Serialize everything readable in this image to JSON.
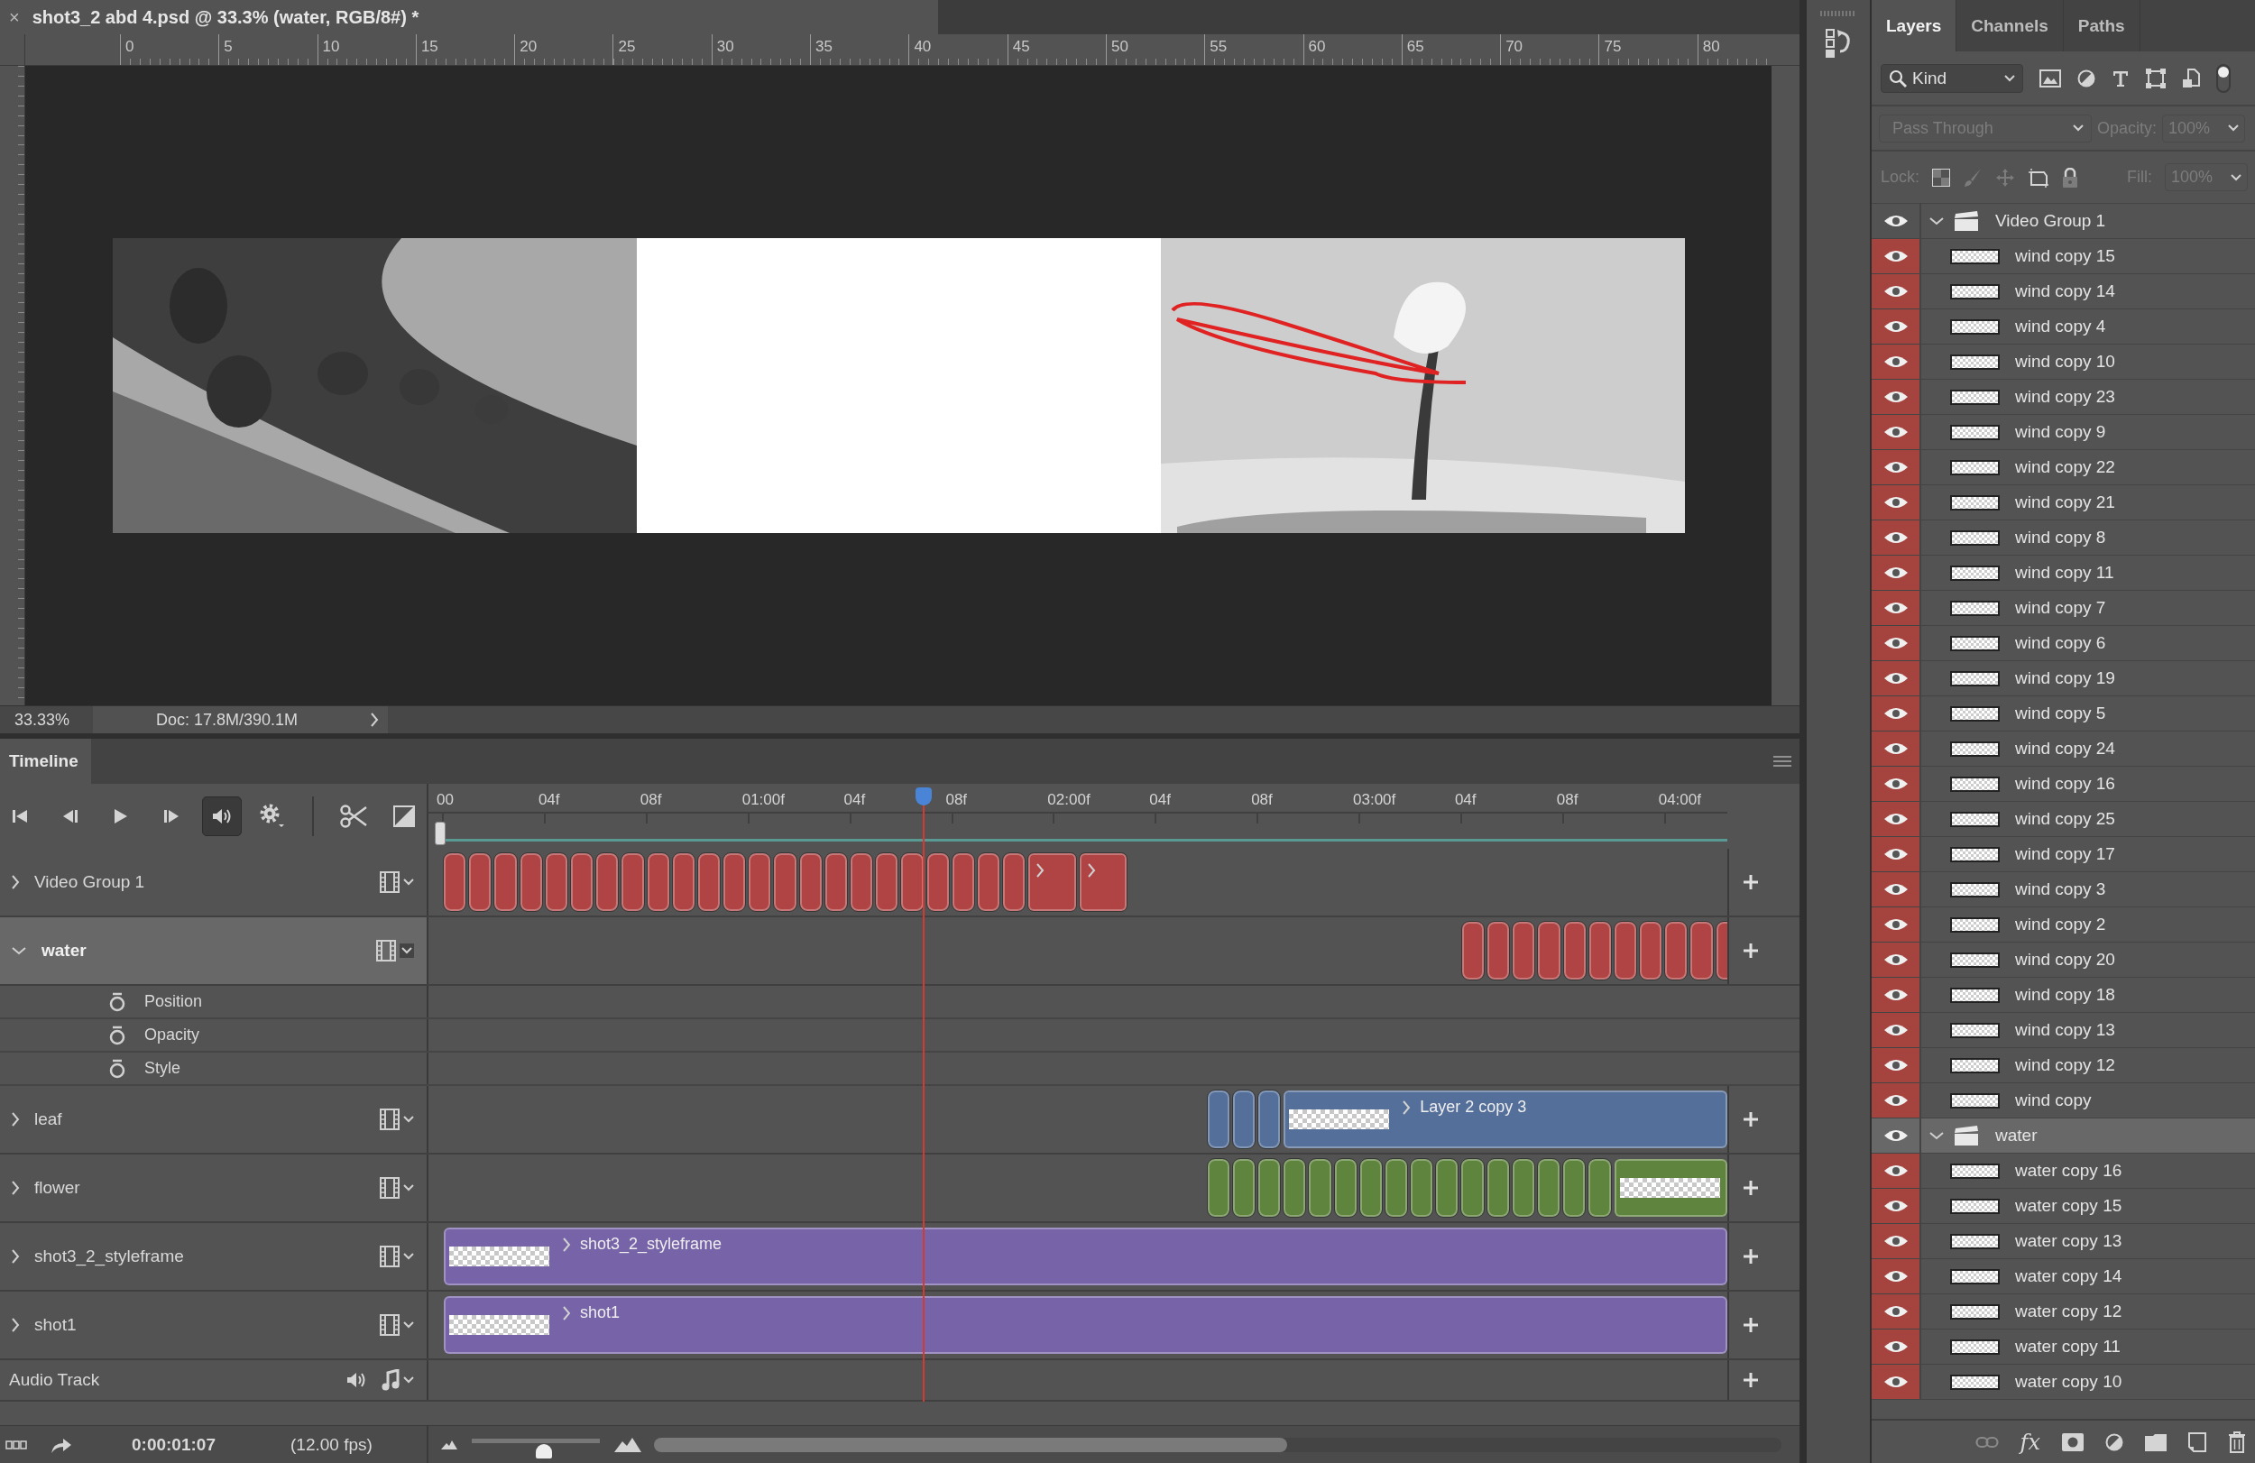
{
  "document_tab": {
    "close": "×",
    "title": "shot3_2 abd 4.psd @ 33.3% (water, RGB/8#) *"
  },
  "ruler": {
    "labels": [
      "0",
      "5",
      "10",
      "15",
      "20",
      "25",
      "30",
      "35",
      "40",
      "45",
      "50",
      "55",
      "60",
      "65",
      "70",
      "75",
      "80"
    ]
  },
  "status_bar": {
    "zoom": "33.33%",
    "doc_info": "Doc: 17.8M/390.1M"
  },
  "timeline": {
    "tab": "Timeline",
    "controls": [
      {
        "kind": "first-frame",
        "pressed": false
      },
      {
        "kind": "previous-frame",
        "pressed": false
      },
      {
        "kind": "play",
        "pressed": false
      },
      {
        "kind": "next-frame",
        "pressed": false
      },
      {
        "kind": "audio",
        "pressed": true
      },
      {
        "kind": "settings",
        "pressed": false
      },
      {
        "kind": "split",
        "pressed": false
      },
      {
        "kind": "transition",
        "pressed": false
      }
    ],
    "ruler_labels": [
      "00",
      "04f",
      "08f",
      "01:00f",
      "04f",
      "08f",
      "02:00f",
      "04f",
      "08f",
      "03:00f",
      "04f",
      "08f",
      "04:00f"
    ],
    "playhead": {
      "level": 0.381
    },
    "tracks": [
      {
        "name": "Video Group 1",
        "kind": "video",
        "expanded": false,
        "selected": false,
        "color": "#b04444",
        "clips": [
          {
            "kind": "frame"
          },
          {
            "kind": "frame"
          },
          {
            "kind": "frame"
          },
          {
            "kind": "frame"
          },
          {
            "kind": "frame"
          },
          {
            "kind": "frame"
          },
          {
            "kind": "frame"
          },
          {
            "kind": "frame"
          },
          {
            "kind": "frame"
          },
          {
            "kind": "frame"
          },
          {
            "kind": "frame"
          },
          {
            "kind": "frame"
          },
          {
            "kind": "frame"
          },
          {
            "kind": "frame"
          },
          {
            "kind": "frame"
          },
          {
            "kind": "frame"
          },
          {
            "kind": "frame"
          },
          {
            "kind": "frame"
          },
          {
            "kind": "frame"
          },
          {
            "kind": "frame"
          },
          {
            "kind": "frame"
          },
          {
            "kind": "frame"
          },
          {
            "kind": "frame"
          },
          {
            "kind": "group"
          },
          {
            "kind": "group"
          }
        ]
      },
      {
        "name": "water",
        "kind": "video",
        "expanded": true,
        "selected": true,
        "color": "#b04444",
        "properties": [
          "Position",
          "Opacity",
          "Style"
        ],
        "clips": [
          {
            "kind": "blank"
          },
          {
            "kind": "blank"
          },
          {
            "kind": "blank"
          },
          {
            "kind": "blank"
          },
          {
            "kind": "blank"
          },
          {
            "kind": "blank"
          },
          {
            "kind": "blank"
          },
          {
            "kind": "blank"
          },
          {
            "kind": "blank"
          },
          {
            "kind": "blank"
          },
          {
            "kind": "blank"
          },
          {
            "kind": "blank"
          },
          {
            "kind": "blank"
          },
          {
            "kind": "blank"
          },
          {
            "kind": "blank"
          },
          {
            "kind": "blank"
          },
          {
            "kind": "blank"
          },
          {
            "kind": "blank"
          },
          {
            "kind": "blank"
          },
          {
            "kind": "blank"
          },
          {
            "kind": "blank"
          },
          {
            "kind": "blank"
          },
          {
            "kind": "blank"
          },
          {
            "kind": "blank"
          },
          {
            "kind": "blank"
          },
          {
            "kind": "blank"
          },
          {
            "kind": "blank"
          },
          {
            "kind": "blank"
          },
          {
            "kind": "blank"
          },
          {
            "kind": "blank"
          },
          {
            "kind": "blank"
          },
          {
            "kind": "blank"
          },
          {
            "kind": "blank"
          },
          {
            "kind": "blank"
          },
          {
            "kind": "blank"
          },
          {
            "kind": "blank"
          },
          {
            "kind": "blank"
          },
          {
            "kind": "blank"
          },
          {
            "kind": "blank"
          },
          {
            "kind": "blank"
          },
          {
            "kind": "frame"
          },
          {
            "kind": "frame"
          },
          {
            "kind": "frame"
          },
          {
            "kind": "frame"
          },
          {
            "kind": "frame"
          },
          {
            "kind": "frame"
          },
          {
            "kind": "frame"
          },
          {
            "kind": "frame"
          },
          {
            "kind": "frame"
          },
          {
            "kind": "frame"
          },
          {
            "kind": "frame"
          }
        ]
      },
      {
        "name": "leaf",
        "kind": "video",
        "expanded": false,
        "selected": false,
        "color": "#536f9a",
        "clips": [
          {
            "kind": "blank"
          },
          {
            "kind": "blank"
          },
          {
            "kind": "blank"
          },
          {
            "kind": "blank"
          },
          {
            "kind": "blank"
          },
          {
            "kind": "blank"
          },
          {
            "kind": "blank"
          },
          {
            "kind": "blank"
          },
          {
            "kind": "blank"
          },
          {
            "kind": "blank"
          },
          {
            "kind": "blank"
          },
          {
            "kind": "blank"
          },
          {
            "kind": "blank"
          },
          {
            "kind": "blank"
          },
          {
            "kind": "blank"
          },
          {
            "kind": "blank"
          },
          {
            "kind": "blank"
          },
          {
            "kind": "blank"
          },
          {
            "kind": "blank"
          },
          {
            "kind": "blank"
          },
          {
            "kind": "blank"
          },
          {
            "kind": "blank"
          },
          {
            "kind": "blank"
          },
          {
            "kind": "blank"
          },
          {
            "kind": "blank"
          },
          {
            "kind": "blank"
          },
          {
            "kind": "blank"
          },
          {
            "kind": "blank"
          },
          {
            "kind": "blank"
          },
          {
            "kind": "blank"
          },
          {
            "kind": "frame"
          },
          {
            "kind": "frame"
          },
          {
            "kind": "frame"
          },
          {
            "kind": "clip",
            "label": "Layer 2 copy 3",
            "thumbnail": true
          }
        ]
      },
      {
        "name": "flower",
        "kind": "video",
        "expanded": false,
        "selected": false,
        "color": "#5f843e",
        "clips": [
          {
            "kind": "blank"
          },
          {
            "kind": "blank"
          },
          {
            "kind": "blank"
          },
          {
            "kind": "blank"
          },
          {
            "kind": "blank"
          },
          {
            "kind": "blank"
          },
          {
            "kind": "blank"
          },
          {
            "kind": "blank"
          },
          {
            "kind": "blank"
          },
          {
            "kind": "blank"
          },
          {
            "kind": "blank"
          },
          {
            "kind": "blank"
          },
          {
            "kind": "blank"
          },
          {
            "kind": "blank"
          },
          {
            "kind": "blank"
          },
          {
            "kind": "blank"
          },
          {
            "kind": "blank"
          },
          {
            "kind": "blank"
          },
          {
            "kind": "blank"
          },
          {
            "kind": "blank"
          },
          {
            "kind": "blank"
          },
          {
            "kind": "blank"
          },
          {
            "kind": "blank"
          },
          {
            "kind": "blank"
          },
          {
            "kind": "blank"
          },
          {
            "kind": "blank"
          },
          {
            "kind": "blank"
          },
          {
            "kind": "blank"
          },
          {
            "kind": "blank"
          },
          {
            "kind": "blank"
          },
          {
            "kind": "frame"
          },
          {
            "kind": "frame"
          },
          {
            "kind": "frame"
          },
          {
            "kind": "frame"
          },
          {
            "kind": "frame"
          },
          {
            "kind": "frame"
          },
          {
            "kind": "frame"
          },
          {
            "kind": "frame"
          },
          {
            "kind": "frame"
          },
          {
            "kind": "frame"
          },
          {
            "kind": "frame"
          },
          {
            "kind": "frame"
          },
          {
            "kind": "frame"
          },
          {
            "kind": "frame"
          },
          {
            "kind": "frame"
          },
          {
            "kind": "frame"
          },
          {
            "kind": "clip",
            "thumbnail": true
          }
        ]
      },
      {
        "name": "shot3_2_styleframe",
        "kind": "video",
        "expanded": false,
        "selected": false,
        "color": "#7763a8",
        "clips": [
          {
            "kind": "clip",
            "label": "shot3_2_styleframe",
            "thumbnail": true
          }
        ]
      },
      {
        "name": "shot1",
        "kind": "video",
        "expanded": false,
        "selected": false,
        "color": "#7763a8",
        "clips": [
          {
            "kind": "clip",
            "label": "shot1",
            "thumbnail": true
          }
        ]
      },
      {
        "name": "Audio Track",
        "kind": "audio",
        "selected": false
      }
    ],
    "current_time": "0:00:01:07",
    "frame_rate": "(12.00 fps)",
    "zoom_slider": {
      "level": 0.56
    }
  },
  "layers_panel": {
    "tabs": [
      {
        "label": "Layers",
        "selected": true
      },
      {
        "label": "Channels",
        "selected": false
      },
      {
        "label": "Paths",
        "selected": false
      }
    ],
    "filter": {
      "value": "Kind"
    },
    "blend_mode": {
      "value": "Pass Through",
      "disabled": true
    },
    "opacity": {
      "label": "Opacity:",
      "value": "100%"
    },
    "lock": {
      "label": "Lock:"
    },
    "fill": {
      "label": "Fill:",
      "value": "100%"
    },
    "layers": [
      {
        "name": "Video Group 1",
        "kind": "group",
        "visible": true,
        "expanded": true,
        "selected": false,
        "children": [
          {
            "name": "wind copy 15",
            "kind": "frame",
            "visible": true,
            "selected": false
          },
          {
            "name": "wind copy 14",
            "kind": "frame",
            "visible": true,
            "selected": false
          },
          {
            "name": "wind copy 4",
            "kind": "frame",
            "visible": true,
            "selected": false
          },
          {
            "name": "wind copy 10",
            "kind": "frame",
            "visible": true,
            "selected": false
          },
          {
            "name": "wind copy 23",
            "kind": "frame",
            "visible": true,
            "selected": false
          },
          {
            "name": "wind copy 9",
            "kind": "frame",
            "visible": true,
            "selected": false
          },
          {
            "name": "wind copy 22",
            "kind": "frame",
            "visible": true,
            "selected": false
          },
          {
            "name": "wind copy 21",
            "kind": "frame",
            "visible": true,
            "selected": false
          },
          {
            "name": "wind copy 8",
            "kind": "frame",
            "visible": true,
            "selected": false
          },
          {
            "name": "wind copy 11",
            "kind": "frame",
            "visible": true,
            "selected": false
          },
          {
            "name": "wind copy 7",
            "kind": "frame",
            "visible": true,
            "selected": false
          },
          {
            "name": "wind copy 6",
            "kind": "frame",
            "visible": true,
            "selected": false
          },
          {
            "name": "wind copy 19",
            "kind": "frame",
            "visible": true,
            "selected": false
          },
          {
            "name": "wind copy 5",
            "kind": "frame",
            "visible": true,
            "selected": false
          },
          {
            "name": "wind copy 24",
            "kind": "frame",
            "visible": true,
            "selected": false
          },
          {
            "name": "wind copy 16",
            "kind": "frame",
            "visible": true,
            "selected": false
          },
          {
            "name": "wind copy 25",
            "kind": "frame",
            "visible": true,
            "selected": false
          },
          {
            "name": "wind copy 17",
            "kind": "frame",
            "visible": true,
            "selected": false
          },
          {
            "name": "wind copy 3",
            "kind": "frame",
            "visible": true,
            "selected": false
          },
          {
            "name": "wind copy 2",
            "kind": "frame",
            "visible": true,
            "selected": false
          },
          {
            "name": "wind copy 20",
            "kind": "frame",
            "visible": true,
            "selected": false
          },
          {
            "name": "wind copy 18",
            "kind": "frame",
            "visible": true,
            "selected": false
          },
          {
            "name": "wind copy 13",
            "kind": "frame",
            "visible": true,
            "selected": false
          },
          {
            "name": "wind copy 12",
            "kind": "frame",
            "visible": true,
            "selected": false
          },
          {
            "name": "wind copy",
            "kind": "frame",
            "visible": true,
            "selected": false
          }
        ]
      },
      {
        "name": "water",
        "kind": "group",
        "visible": true,
        "expanded": true,
        "selected": true,
        "children": [
          {
            "name": "water copy 16",
            "kind": "frame",
            "visible": true,
            "selected": false
          },
          {
            "name": "water copy 15",
            "kind": "frame",
            "visible": true,
            "selected": false
          },
          {
            "name": "water copy 13",
            "kind": "frame",
            "visible": true,
            "selected": false
          },
          {
            "name": "water copy 14",
            "kind": "frame",
            "visible": true,
            "selected": false
          },
          {
            "name": "water copy 12",
            "kind": "frame",
            "visible": true,
            "selected": false
          },
          {
            "name": "water copy 11",
            "kind": "frame",
            "visible": true,
            "selected": false
          },
          {
            "name": "water copy 10",
            "kind": "frame",
            "visible": true,
            "selected": false
          }
        ]
      }
    ],
    "toolbar": {
      "fx": "fx"
    }
  }
}
